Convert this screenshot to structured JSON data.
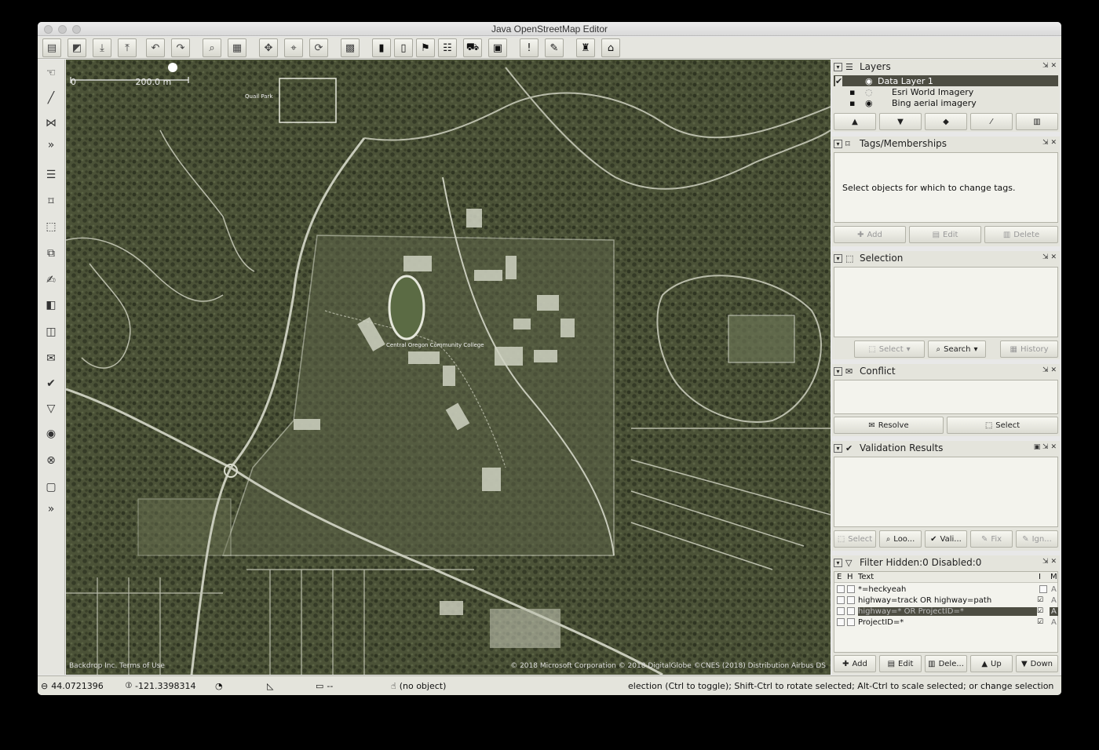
{
  "window": {
    "title": "Java OpenStreetMap Editor"
  },
  "map": {
    "scale_start": "0",
    "scale_label": "200.0 m",
    "campus_label": "Central Oregon Community College",
    "park_label": "Quail Park",
    "attrib_left": "Backdrop Inc. Terms of Use",
    "attrib_right": "© 2018 Microsoft Corporation © 2018 DigitalGlobe ©CNES (2018) Distribution Airbus DS"
  },
  "layers": {
    "title": "Layers",
    "items": [
      {
        "name": "Data Layer 1",
        "selected": true
      },
      {
        "name": "Esri World Imagery",
        "selected": false
      },
      {
        "name": "Bing aerial imagery",
        "selected": false
      }
    ]
  },
  "tags": {
    "title": "Tags/Memberships",
    "message": "Select objects for which to change tags.",
    "add": "Add",
    "edit": "Edit",
    "delete": "Delete"
  },
  "selection": {
    "title": "Selection",
    "select": "Select",
    "search": "Search",
    "history": "History"
  },
  "conflict": {
    "title": "Conflict",
    "resolve": "Resolve",
    "select": "Select"
  },
  "validation": {
    "title": "Validation Results",
    "select": "Select",
    "lookup": "Loo...",
    "validate": "Vali...",
    "fix": "Fix",
    "ignore": "Ign..."
  },
  "filter": {
    "title": "Filter Hidden:0 Disabled:0",
    "col_e": "E",
    "col_h": "H",
    "col_text": "Text",
    "col_i": "I",
    "col_m": "M",
    "rows": [
      {
        "text": "*=heckyeah",
        "m": "A",
        "selected": false
      },
      {
        "text": "highway=track OR highway=path",
        "m": "A",
        "selected": false
      },
      {
        "text": "highway=* OR ProjectID=*",
        "m": "A",
        "selected": true
      },
      {
        "text": "ProjectID=*",
        "m": "A",
        "selected": false
      }
    ],
    "add": "Add",
    "edit": "Edit",
    "delete": "Dele...",
    "up": "Up",
    "down": "Down"
  },
  "status": {
    "lat": "44.0721396",
    "lon": "-121.3398314",
    "dist": "--",
    "object": "(no object)",
    "help": "election (Ctrl to toggle); Shift-Ctrl to rotate selected; Alt-Ctrl to scale selected; or change selection"
  },
  "colors": {
    "imagery": "#4b5237",
    "panel": "#e4e4dc",
    "selected": "#4d4d42"
  }
}
